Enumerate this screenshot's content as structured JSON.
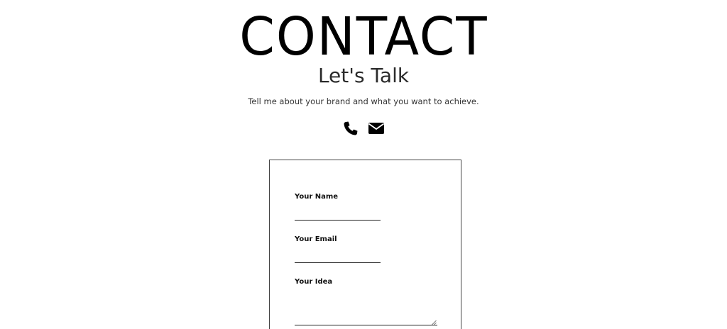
{
  "hero": {
    "title": "CONTACT",
    "subtitle": "Let's Talk",
    "tagline": "Tell me about your brand and what you want to achieve."
  },
  "contact_icons": [
    {
      "icon": "phone-icon"
    },
    {
      "icon": "envelope-icon"
    }
  ],
  "form": {
    "name_label": "Your Name",
    "name_value": "",
    "email_label": "Your Email",
    "email_value": "",
    "idea_label": "Your Idea",
    "idea_value": ""
  }
}
